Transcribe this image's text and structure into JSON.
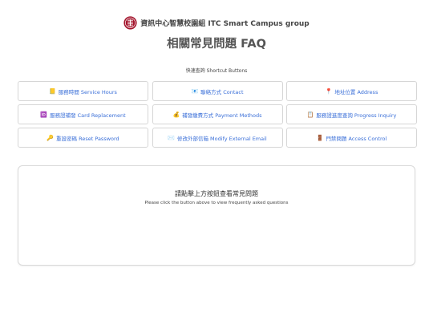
{
  "header": {
    "logo_icon": "university-seal-icon",
    "group_name": "資訊中心智慧校園組 ITC Smart Campus group",
    "page_title": "相關常見問題 FAQ"
  },
  "shortcuts": {
    "label": "快速查詢 Shortcut Buttons",
    "buttons": [
      {
        "icon": "📒",
        "icon_name": "notebook-icon",
        "label": "服務時間 Service Hours"
      },
      {
        "icon": "📧",
        "icon_name": "email-icon",
        "label": "聯絡方式 Contact"
      },
      {
        "icon": "📍",
        "icon_name": "location-pin-icon",
        "label": "地址位置 Address"
      },
      {
        "icon": "🆔",
        "icon_name": "id-card-icon",
        "label": "服務證補發 Card Replacement"
      },
      {
        "icon": "💰",
        "icon_name": "money-bag-icon",
        "label": "補發繳費方式 Payment Methods"
      },
      {
        "icon": "📋",
        "icon_name": "clipboard-icon",
        "label": "服務證進度查詢 Progress Inquiry"
      },
      {
        "icon": "🔑",
        "icon_name": "key-icon",
        "label": "重設密碼 Reset Password"
      },
      {
        "icon": "✉️",
        "icon_name": "envelope-icon",
        "label": "修改外部信箱 Modify External Email"
      },
      {
        "icon": "🚪",
        "icon_name": "door-icon",
        "label": "門禁問題 Access Control"
      }
    ]
  },
  "panel": {
    "message_zh": "請點擊上方按鈕查看常見問題",
    "message_en": "Please click the button above to view frequently asked questions"
  },
  "colors": {
    "accent_link": "#3a6fd8",
    "logo_red": "#a3142c",
    "border": "#d6d6d6"
  }
}
